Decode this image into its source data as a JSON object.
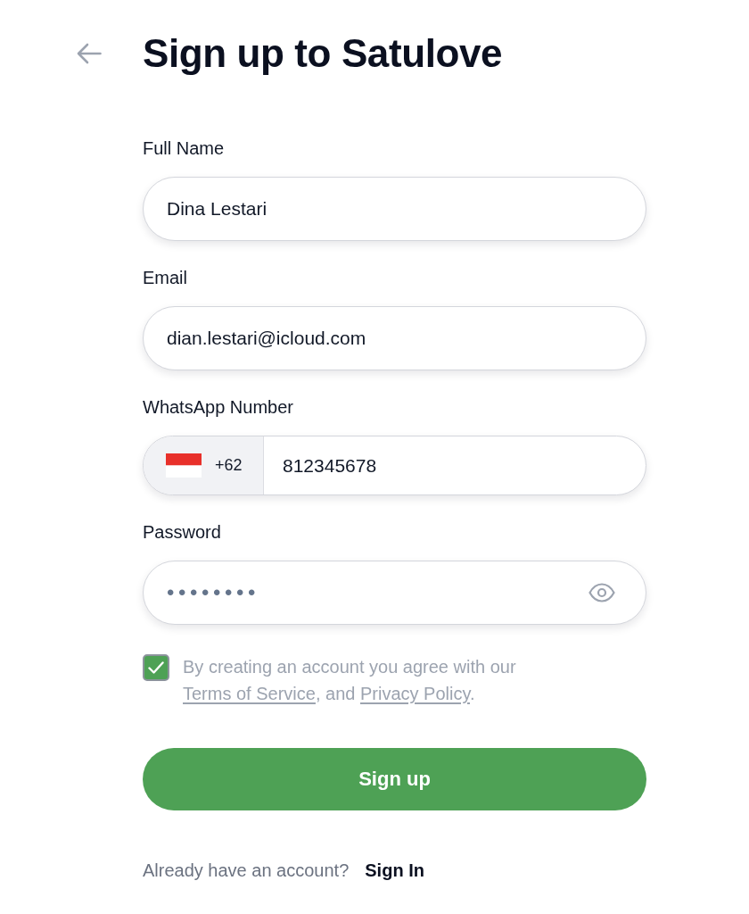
{
  "header": {
    "title": "Sign up to Satulove"
  },
  "fields": [
    {
      "kind": "text",
      "label": "Full Name",
      "value": "Dina Lestari"
    },
    {
      "kind": "text",
      "label": "Email",
      "value": "dian.lestari@icloud.com"
    },
    {
      "kind": "phone",
      "label": "WhatsApp Number",
      "country_code": "+62",
      "value": "812345678"
    },
    {
      "kind": "password",
      "label": "Password",
      "value": "••••••••"
    }
  ],
  "terms": {
    "checked": true,
    "parts": [
      {
        "kind": "text",
        "text": "By creating an account you agree with our "
      },
      {
        "kind": "link",
        "text": "Terms of Service"
      },
      {
        "kind": "text",
        "text": ", and "
      },
      {
        "kind": "link",
        "text": "Privacy Policy"
      },
      {
        "kind": "text",
        "text": "."
      }
    ]
  },
  "submit_button": {
    "label": "Sign up"
  },
  "footer": {
    "prompt": "Already have an account?",
    "link": "Sign In"
  }
}
